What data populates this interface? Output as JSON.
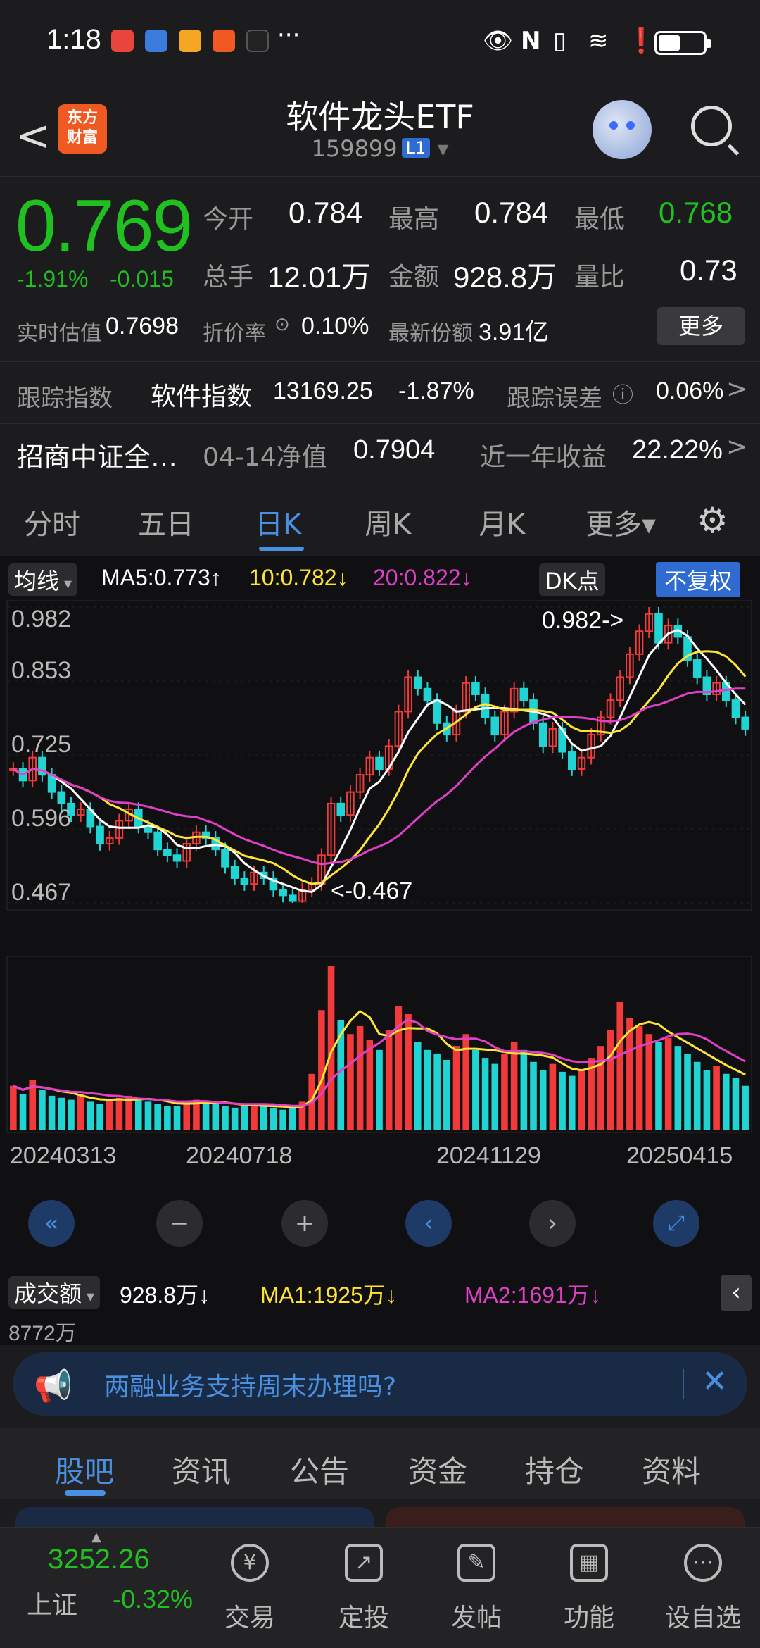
{
  "status_bar": {
    "time": "1:18",
    "dots": "···",
    "app_icons": [
      {
        "name": "book-app-icon",
        "color": "#e8453c"
      },
      {
        "name": "baidu-app-icon",
        "color": "#3b7bdc"
      },
      {
        "name": "weibo-app-icon",
        "color": "#f5a623"
      },
      {
        "name": "paper-plane-app-icon",
        "color": "#f05a22"
      },
      {
        "name": "tiktok-app-icon",
        "color": "#222222"
      }
    ]
  },
  "header": {
    "title": "软件龙头ETF",
    "code": "159899",
    "level_badge": "L1",
    "logo_line1": "东方",
    "logo_line2": "财富"
  },
  "quote": {
    "price": "0.769",
    "change_pct": "-1.91%",
    "change_abs": "-0.015",
    "open_label": "今开",
    "open": "0.784",
    "high_label": "最高",
    "high": "0.784",
    "low_label": "最低",
    "low": "0.768",
    "volume_label": "总手",
    "volume": "12.01万",
    "amount_label": "金额",
    "amount": "928.8万",
    "ratio_label": "量比",
    "ratio": "0.73",
    "est_label": "实时估值",
    "est": "0.7698",
    "discount_label": "折价率",
    "discount": "0.10%",
    "shares_label": "最新份额",
    "shares": "3.91亿",
    "more_label": "更多"
  },
  "tracking": {
    "label": "跟踪指数",
    "index_name": "软件指数",
    "index_value": "13169.25",
    "index_change": "-1.87%",
    "error_label": "跟踪误差",
    "error_value": "0.06%"
  },
  "fund": {
    "name": "招商中证全…",
    "nav_label": "04-14净值",
    "nav_value": "0.7904",
    "return_label": "近一年收益",
    "return_value": "22.22%"
  },
  "period_tabs": [
    "分时",
    "五日",
    "日K",
    "周K",
    "月K",
    "更多▾"
  ],
  "active_period": "日K",
  "chart_header": {
    "indicator": "均线",
    "ma5": "MA5:0.773↑",
    "ma10": "10:0.782↓",
    "ma20": "20:0.822↓",
    "dk_label": "DK点",
    "adjust_label": "不复权"
  },
  "volume_header": {
    "indicator": "成交额",
    "current": "928.8万↓",
    "ma1": "MA1:1925万↓",
    "ma2": "MA2:1691万↓",
    "max_label": "8772万"
  },
  "chart_data": {
    "type": "candlestick",
    "y_ticks": [
      "0.982",
      "0.853",
      "0.725",
      "0.596",
      "0.467"
    ],
    "ylim": [
      0.467,
      0.982
    ],
    "x_ticks": [
      "20240313",
      "20240718",
      "20241129",
      "20250415"
    ],
    "high_annotation": "0.982->",
    "low_annotation": "<-0.467",
    "close_series": [
      0.7,
      0.68,
      0.72,
      0.69,
      0.66,
      0.64,
      0.62,
      0.63,
      0.6,
      0.57,
      0.58,
      0.61,
      0.63,
      0.6,
      0.59,
      0.56,
      0.55,
      0.54,
      0.57,
      0.59,
      0.58,
      0.56,
      0.53,
      0.51,
      0.5,
      0.52,
      0.51,
      0.49,
      0.48,
      0.47,
      0.49,
      0.5,
      0.55,
      0.64,
      0.62,
      0.66,
      0.69,
      0.72,
      0.7,
      0.74,
      0.8,
      0.86,
      0.84,
      0.82,
      0.78,
      0.76,
      0.8,
      0.85,
      0.83,
      0.79,
      0.76,
      0.8,
      0.84,
      0.82,
      0.78,
      0.74,
      0.77,
      0.73,
      0.7,
      0.72,
      0.76,
      0.79,
      0.82,
      0.86,
      0.9,
      0.94,
      0.97,
      0.92,
      0.95,
      0.93,
      0.89,
      0.86,
      0.83,
      0.85,
      0.82,
      0.79,
      0.77
    ],
    "ma_colors": {
      "ma5": "#ffffff",
      "ma10": "#ffe533",
      "ma20": "#e040c8"
    },
    "volume_series": [
      22,
      18,
      25,
      20,
      17,
      16,
      15,
      18,
      14,
      13,
      15,
      16,
      17,
      15,
      14,
      13,
      12,
      12,
      14,
      15,
      14,
      13,
      12,
      11,
      12,
      13,
      12,
      11,
      10,
      11,
      14,
      28,
      60,
      82,
      55,
      48,
      52,
      45,
      40,
      50,
      62,
      58,
      44,
      40,
      38,
      35,
      42,
      48,
      40,
      36,
      33,
      38,
      44,
      40,
      34,
      30,
      33,
      29,
      27,
      30,
      36,
      42,
      50,
      64,
      56,
      52,
      48,
      44,
      46,
      42,
      38,
      34,
      30,
      32,
      28,
      26,
      22
    ]
  },
  "banner": {
    "text": "两融业务支持周末办理吗?"
  },
  "sub_tabs": [
    "股吧",
    "资讯",
    "公告",
    "资金",
    "持仓",
    "资料"
  ],
  "bottom_nav": {
    "index_value": "3252.26",
    "index_name": "上证",
    "index_change": "-0.32%",
    "items": [
      {
        "label": "交易",
        "icon": "yen"
      },
      {
        "label": "定投",
        "icon": "chart"
      },
      {
        "label": "发帖",
        "icon": "pen"
      },
      {
        "label": "功能",
        "icon": "grid"
      },
      {
        "label": "设自选",
        "icon": "dots"
      }
    ]
  }
}
